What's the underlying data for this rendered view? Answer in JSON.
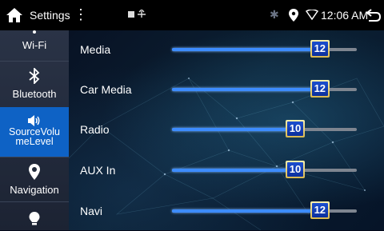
{
  "status_bar": {
    "title": "Settings",
    "menu_icon": "more-vert-icon",
    "time": "12:06 AM",
    "icons": [
      "home-icon",
      "usb-icon",
      "bluetooth-icon",
      "location-icon",
      "wifi-icon",
      "back-icon"
    ]
  },
  "sidebar": {
    "items": [
      {
        "label": "Wi-Fi",
        "icon": "wifi-icon"
      },
      {
        "label": "Bluetooth",
        "icon": "bluetooth-icon"
      },
      {
        "label": "SourceVolumeLevel",
        "line1": "SourceVolu",
        "line2": "meLevel",
        "icon": "speaker-icon",
        "selected": true
      },
      {
        "label": "Navigation",
        "icon": "location-pin-icon"
      },
      {
        "label": "",
        "icon": "lightbulb-icon"
      }
    ]
  },
  "volume": {
    "max": 15,
    "rows": [
      {
        "label": "Media",
        "value": "12",
        "level": 12
      },
      {
        "label": "Car Media",
        "value": "12",
        "level": 12
      },
      {
        "label": "Radio",
        "value": "10",
        "level": 10
      },
      {
        "label": "AUX In",
        "value": "10",
        "level": 10
      },
      {
        "label": "Navi",
        "value": "12",
        "level": 12
      }
    ]
  },
  "colors": {
    "accent": "#0e62c5",
    "slider_fill": "#3d8cff",
    "slider_track": "#7e8590",
    "knob_border": "#e8cf6a"
  }
}
